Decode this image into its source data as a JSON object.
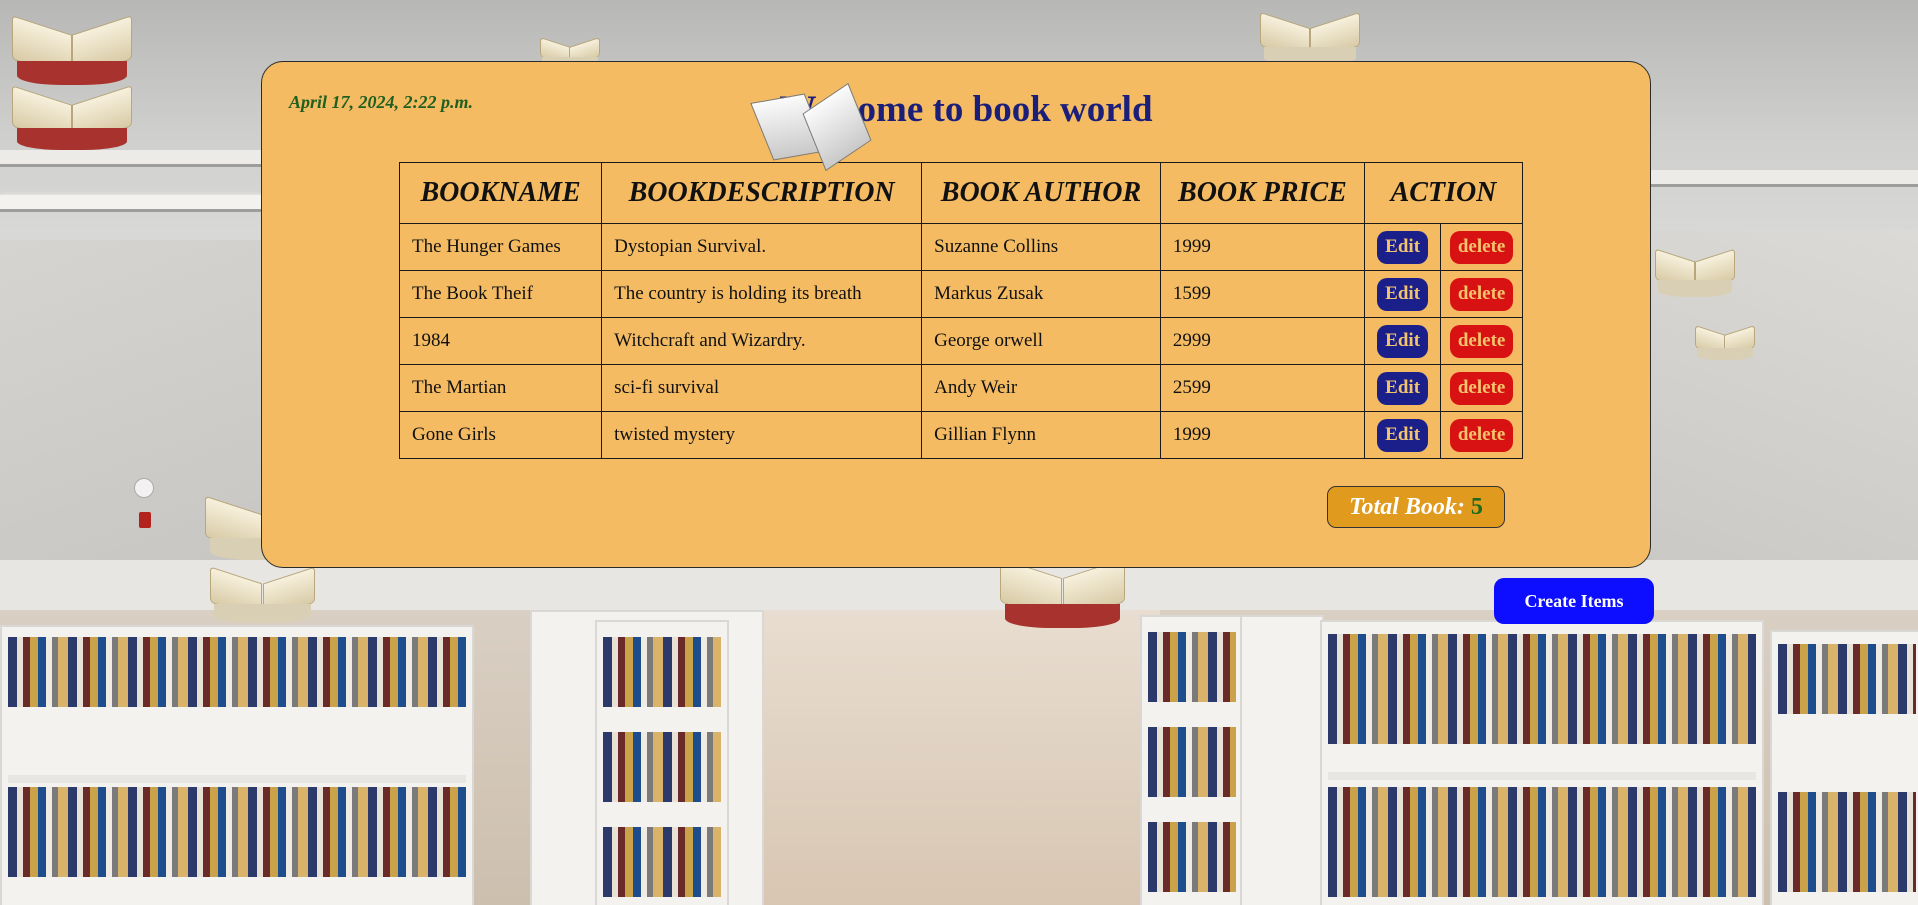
{
  "header": {
    "date": "April 17, 2024, 2:22 p.m.",
    "title": "Welcome to book world"
  },
  "table": {
    "columns": [
      "BOOKNAME",
      "BOOKDESCRIPTION",
      "BOOK AUTHOR",
      "BOOK PRICE",
      "ACTION"
    ],
    "rows": [
      {
        "name": "The Hunger Games",
        "description": "Dystopian Survival.",
        "author": "Suzanne Collins",
        "price": "1999"
      },
      {
        "name": "The Book Theif",
        "description": "The country is holding its breath",
        "author": "Markus Zusak",
        "price": "1599"
      },
      {
        "name": "1984",
        "description": "Witchcraft and Wizardry.",
        "author": "George orwell",
        "price": "2999"
      },
      {
        "name": "The Martian",
        "description": "sci-fi survival",
        "author": "Andy Weir",
        "price": "2599"
      },
      {
        "name": "Gone Girls",
        "description": "twisted mystery",
        "author": "Gillian Flynn",
        "price": "1999"
      }
    ],
    "edit_label": "Edit",
    "delete_label": "delete"
  },
  "summary": {
    "total_label": "Total Book:",
    "total_count": "5"
  },
  "actions": {
    "create_label": "Create Items"
  },
  "colors": {
    "card": "#f4bb63",
    "title": "#1c1f7a",
    "edit": "#1a1f8a",
    "delete": "#d81212",
    "create": "#0d0dff",
    "date": "#1f5f1f"
  }
}
